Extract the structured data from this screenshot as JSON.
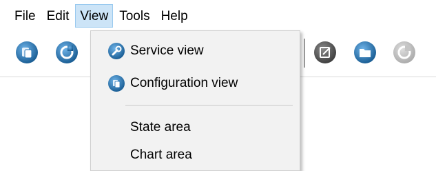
{
  "menubar": {
    "items": [
      {
        "label": "File"
      },
      {
        "label": "Edit"
      },
      {
        "label": "View"
      },
      {
        "label": "Tools"
      },
      {
        "label": "Help"
      }
    ]
  },
  "toolbar": {
    "buttons": [
      {
        "icon": "database-icon",
        "color": "#1f6fb2"
      },
      {
        "icon": "refresh-icon",
        "color": "#1f6fb2"
      },
      {
        "icon": "edit-icon",
        "color": "#4a4a4a"
      },
      {
        "icon": "open-folder-icon",
        "color": "#1f6fb2"
      },
      {
        "icon": "sync-icon",
        "color": "#b0b0b0"
      }
    ]
  },
  "view_menu": {
    "items": [
      {
        "label": "Service view",
        "icon": "wrench-icon"
      },
      {
        "label": "Configuration view",
        "icon": "configuration-icon"
      },
      {
        "label": "State area"
      },
      {
        "label": "Chart area"
      }
    ]
  },
  "colors": {
    "menu_open_bg": "#cce4f7",
    "dropdown_bg": "#f2f2f2",
    "icon_blue": "#1f6fb2"
  }
}
